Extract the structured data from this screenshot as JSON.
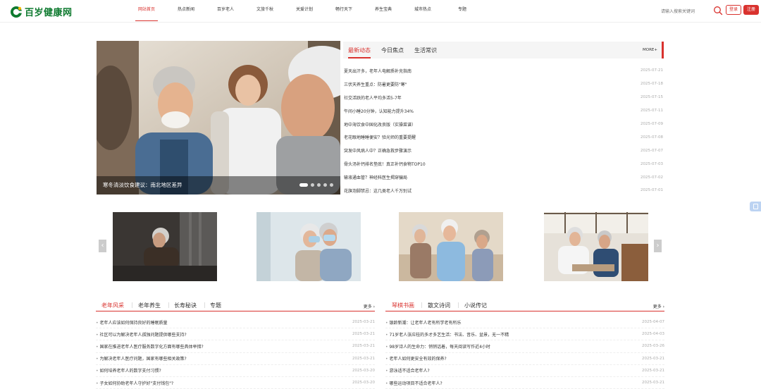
{
  "header": {
    "logo_text": "百岁健康网",
    "nav": [
      "网站首页",
      "热点新闻",
      "百岁老人",
      "文旅千秋",
      "关爱计划",
      "畅行天下",
      "养生宝典",
      "城市热点",
      "专题"
    ],
    "search_placeholder": "请输入搜索关键词",
    "login_label": "登录",
    "register_label": "注册"
  },
  "hero": {
    "caption": "寒冬清淡饮食建议：南北地区差异",
    "dots": 5,
    "active_dot": 0
  },
  "news": {
    "tabs": [
      "最新动态",
      "今日焦点",
      "生活常识"
    ],
    "more": "MORE+",
    "items": [
      {
        "title": "夏天出汗多，老年人电解质补充指南",
        "date": "2025-07-21"
      },
      {
        "title": "三伏天养生重点：防暑更要防\"寒\"",
        "date": "2025-07-18"
      },
      {
        "title": "社交活跃的老人平均多活5-7年",
        "date": "2025-07-15"
      },
      {
        "title": "午间小睡20分钟，认知能力提升34%",
        "date": "2025-07-11"
      },
      {
        "title": "地中海饮食中国化改良版（实操菜谱）",
        "date": "2025-07-09"
      },
      {
        "title": "老花眼地睡睡便安？验光师的重要提醒",
        "date": "2025-07-08"
      },
      {
        "title": "突发中风病人中？正确急救步骤演示",
        "date": "2025-07-07"
      },
      {
        "title": "骨头汤补钙排名垫底！真正补钙食物TOP10",
        "date": "2025-07-03"
      },
      {
        "title": "输液通血管？神经科医生揭穿骗局",
        "date": "2025-07-02"
      },
      {
        "title": "花旗泡脚禁忌：这几类老人千万别试",
        "date": "2025-07-01"
      }
    ]
  },
  "carousel": {
    "prev": "‹",
    "next": "›"
  },
  "section_left": {
    "tabs": [
      "老年风采",
      "老年养生",
      "长寿秘诀",
      "专题"
    ],
    "more": "更多 ›",
    "items": [
      {
        "title": "老年人应该如何保持良好的睡眠质量",
        "date": "2025-03-21"
      },
      {
        "title": "社区可以为解决老年人孤独问题提供哪些支持?",
        "date": "2025-03-21"
      },
      {
        "title": "国家在推进老年人医疗服务数字化方面有哪些具体举措?",
        "date": "2025-03-21"
      },
      {
        "title": "为解决老年人医疗问题，国家有哪些相关政策?",
        "date": "2025-03-21"
      },
      {
        "title": "如何培养老年人的数字支付习惯?",
        "date": "2025-03-20"
      },
      {
        "title": "子女如何协助老年人守护好\"支付钱包\"?",
        "date": "2025-03-20"
      }
    ]
  },
  "section_right": {
    "tabs": [
      "琴棋书画",
      "散文诗词",
      "小说传记"
    ],
    "more": "更多 ›",
    "items": [
      {
        "title": "银龄新潮：让老年人老有所学老有所乐",
        "date": "2025-04-07"
      },
      {
        "title": "71岁老人张应桂的多才多艺生活：书法、音乐、盆景，无一不精",
        "date": "2025-04-03"
      },
      {
        "title": "98岁诗人的生命力：悄悄话着，每天阅读写作近4小时",
        "date": "2025-03-26"
      },
      {
        "title": "老年人如何更安全有效的保养?",
        "date": "2025-03-21"
      },
      {
        "title": "游泳适不适合老年人?",
        "date": "2025-03-21"
      },
      {
        "title": "哪些运动项目不适合老年人?",
        "date": "2025-03-21"
      }
    ]
  }
}
